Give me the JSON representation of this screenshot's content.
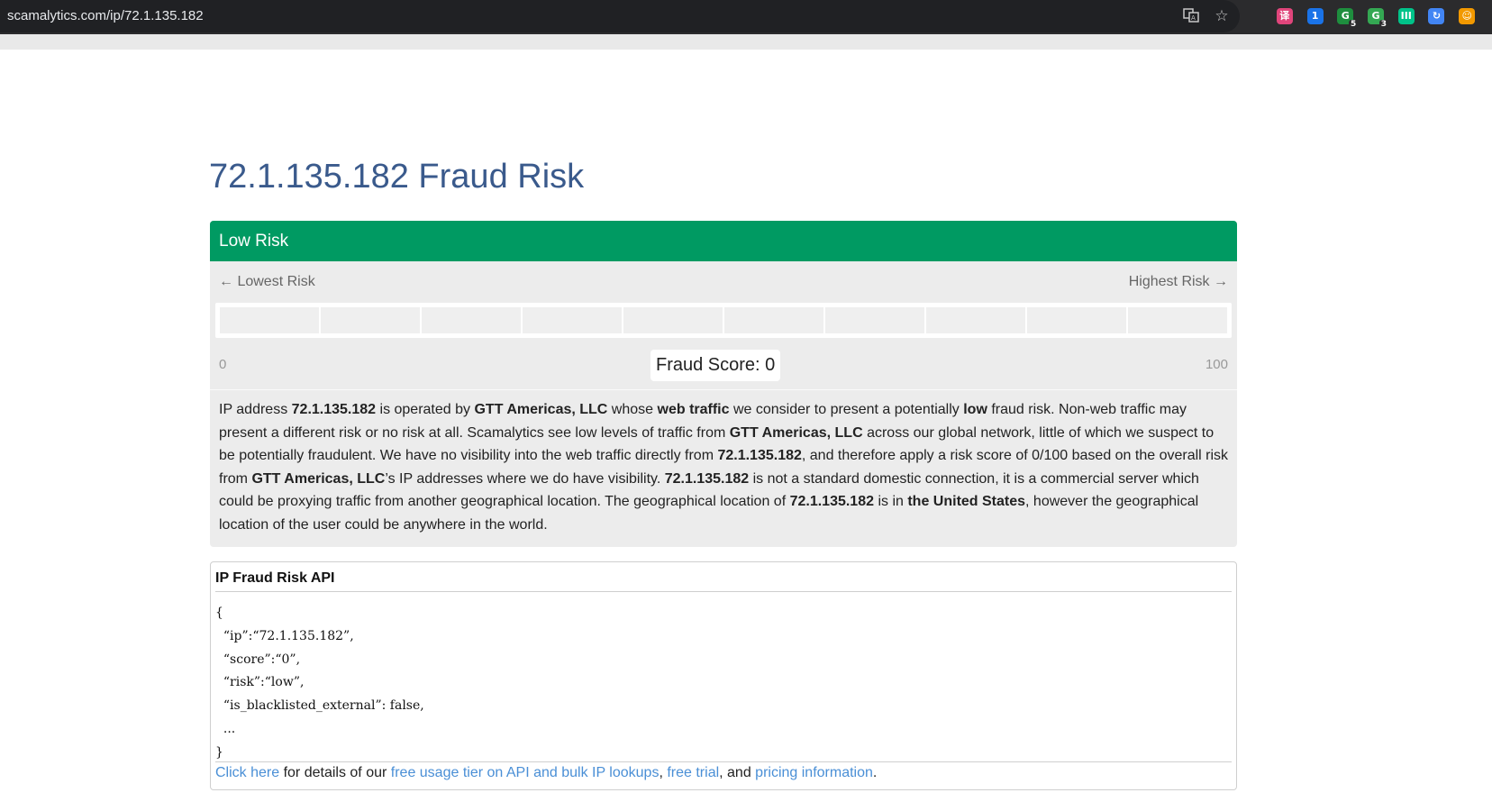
{
  "browser": {
    "url": "scamalytics.com/ip/72.1.135.182",
    "icons": [
      "translate-icon",
      "bookmark-star-icon"
    ],
    "extensions": [
      {
        "name": "ext-icon-1",
        "glyph": "译",
        "color": "#e0457b",
        "badge": ""
      },
      {
        "name": "ext-icon-onepassword",
        "glyph": "1",
        "color": "#1a73e8",
        "badge": ""
      },
      {
        "name": "ext-icon-green-shield",
        "glyph": "G",
        "color": "#1e8e3e",
        "badge": "5"
      },
      {
        "name": "ext-icon-green-shield-2",
        "glyph": "G",
        "color": "#34a853",
        "badge": "3"
      },
      {
        "name": "ext-icon-bars",
        "glyph": "III",
        "color": "#00c389",
        "badge": ""
      },
      {
        "name": "ext-icon-share",
        "glyph": "↻",
        "color": "#4285f4",
        "badge": ""
      },
      {
        "name": "ext-icon-fox",
        "glyph": "☺",
        "color": "#f29900",
        "badge": ""
      }
    ]
  },
  "page": {
    "title": "72.1.135.182 Fraud Risk"
  },
  "risk": {
    "header": "Low Risk",
    "header_color": "#009a62",
    "scale_left": "← Lowest Risk",
    "scale_right": "Highest Risk →",
    "score_min": "0",
    "score_max": "100",
    "score_label": "Fraud Score: ",
    "score_value": "0",
    "score_fraction": 0.0,
    "segments": 10
  },
  "description": {
    "ip": "72.1.135.182",
    "isp": "GTT Americas, LLC",
    "t1": "IP address ",
    "t2": " is operated by ",
    "t3": " whose ",
    "b_web": "web traffic",
    "t4": " we consider to present a potentially ",
    "b_low": "low",
    "t5": " fraud risk. Non-web traffic may present a different risk or no risk at all. Scamalytics see low levels of traffic from ",
    "t6": " across our global network, little of which we suspect to be potentially fraudulent. We have no visibility into the web traffic directly from ",
    "t7": ", and therefore apply a risk score of 0/100 based on the overall risk from ",
    "t8": "’s IP addresses where we do have visibility. ",
    "t9": " is not a standard domestic connection, it is a commercial server which could be proxying traffic from another geographical location. The geographical location of ",
    "t10": " is in ",
    "b_country": "the United States",
    "t11": ", however the geographical location of the user could be anywhere in the world."
  },
  "api": {
    "title": "IP Fraud Risk API",
    "code_lines": [
      "{",
      "  “ip”:“72.1.135.182”,",
      "  “score”:“0”,",
      "  “risk”:“low”,",
      "  “is_blacklisted_external”: false,",
      "  ...",
      "}"
    ],
    "footer_link1": "Click here",
    "footer_t1": " for details of our ",
    "footer_link2": "free usage tier on API and bulk IP lookups",
    "footer_t2": ", ",
    "footer_link3": "free trial",
    "footer_t3": ", and ",
    "footer_link4": "pricing information",
    "footer_t4": "."
  }
}
